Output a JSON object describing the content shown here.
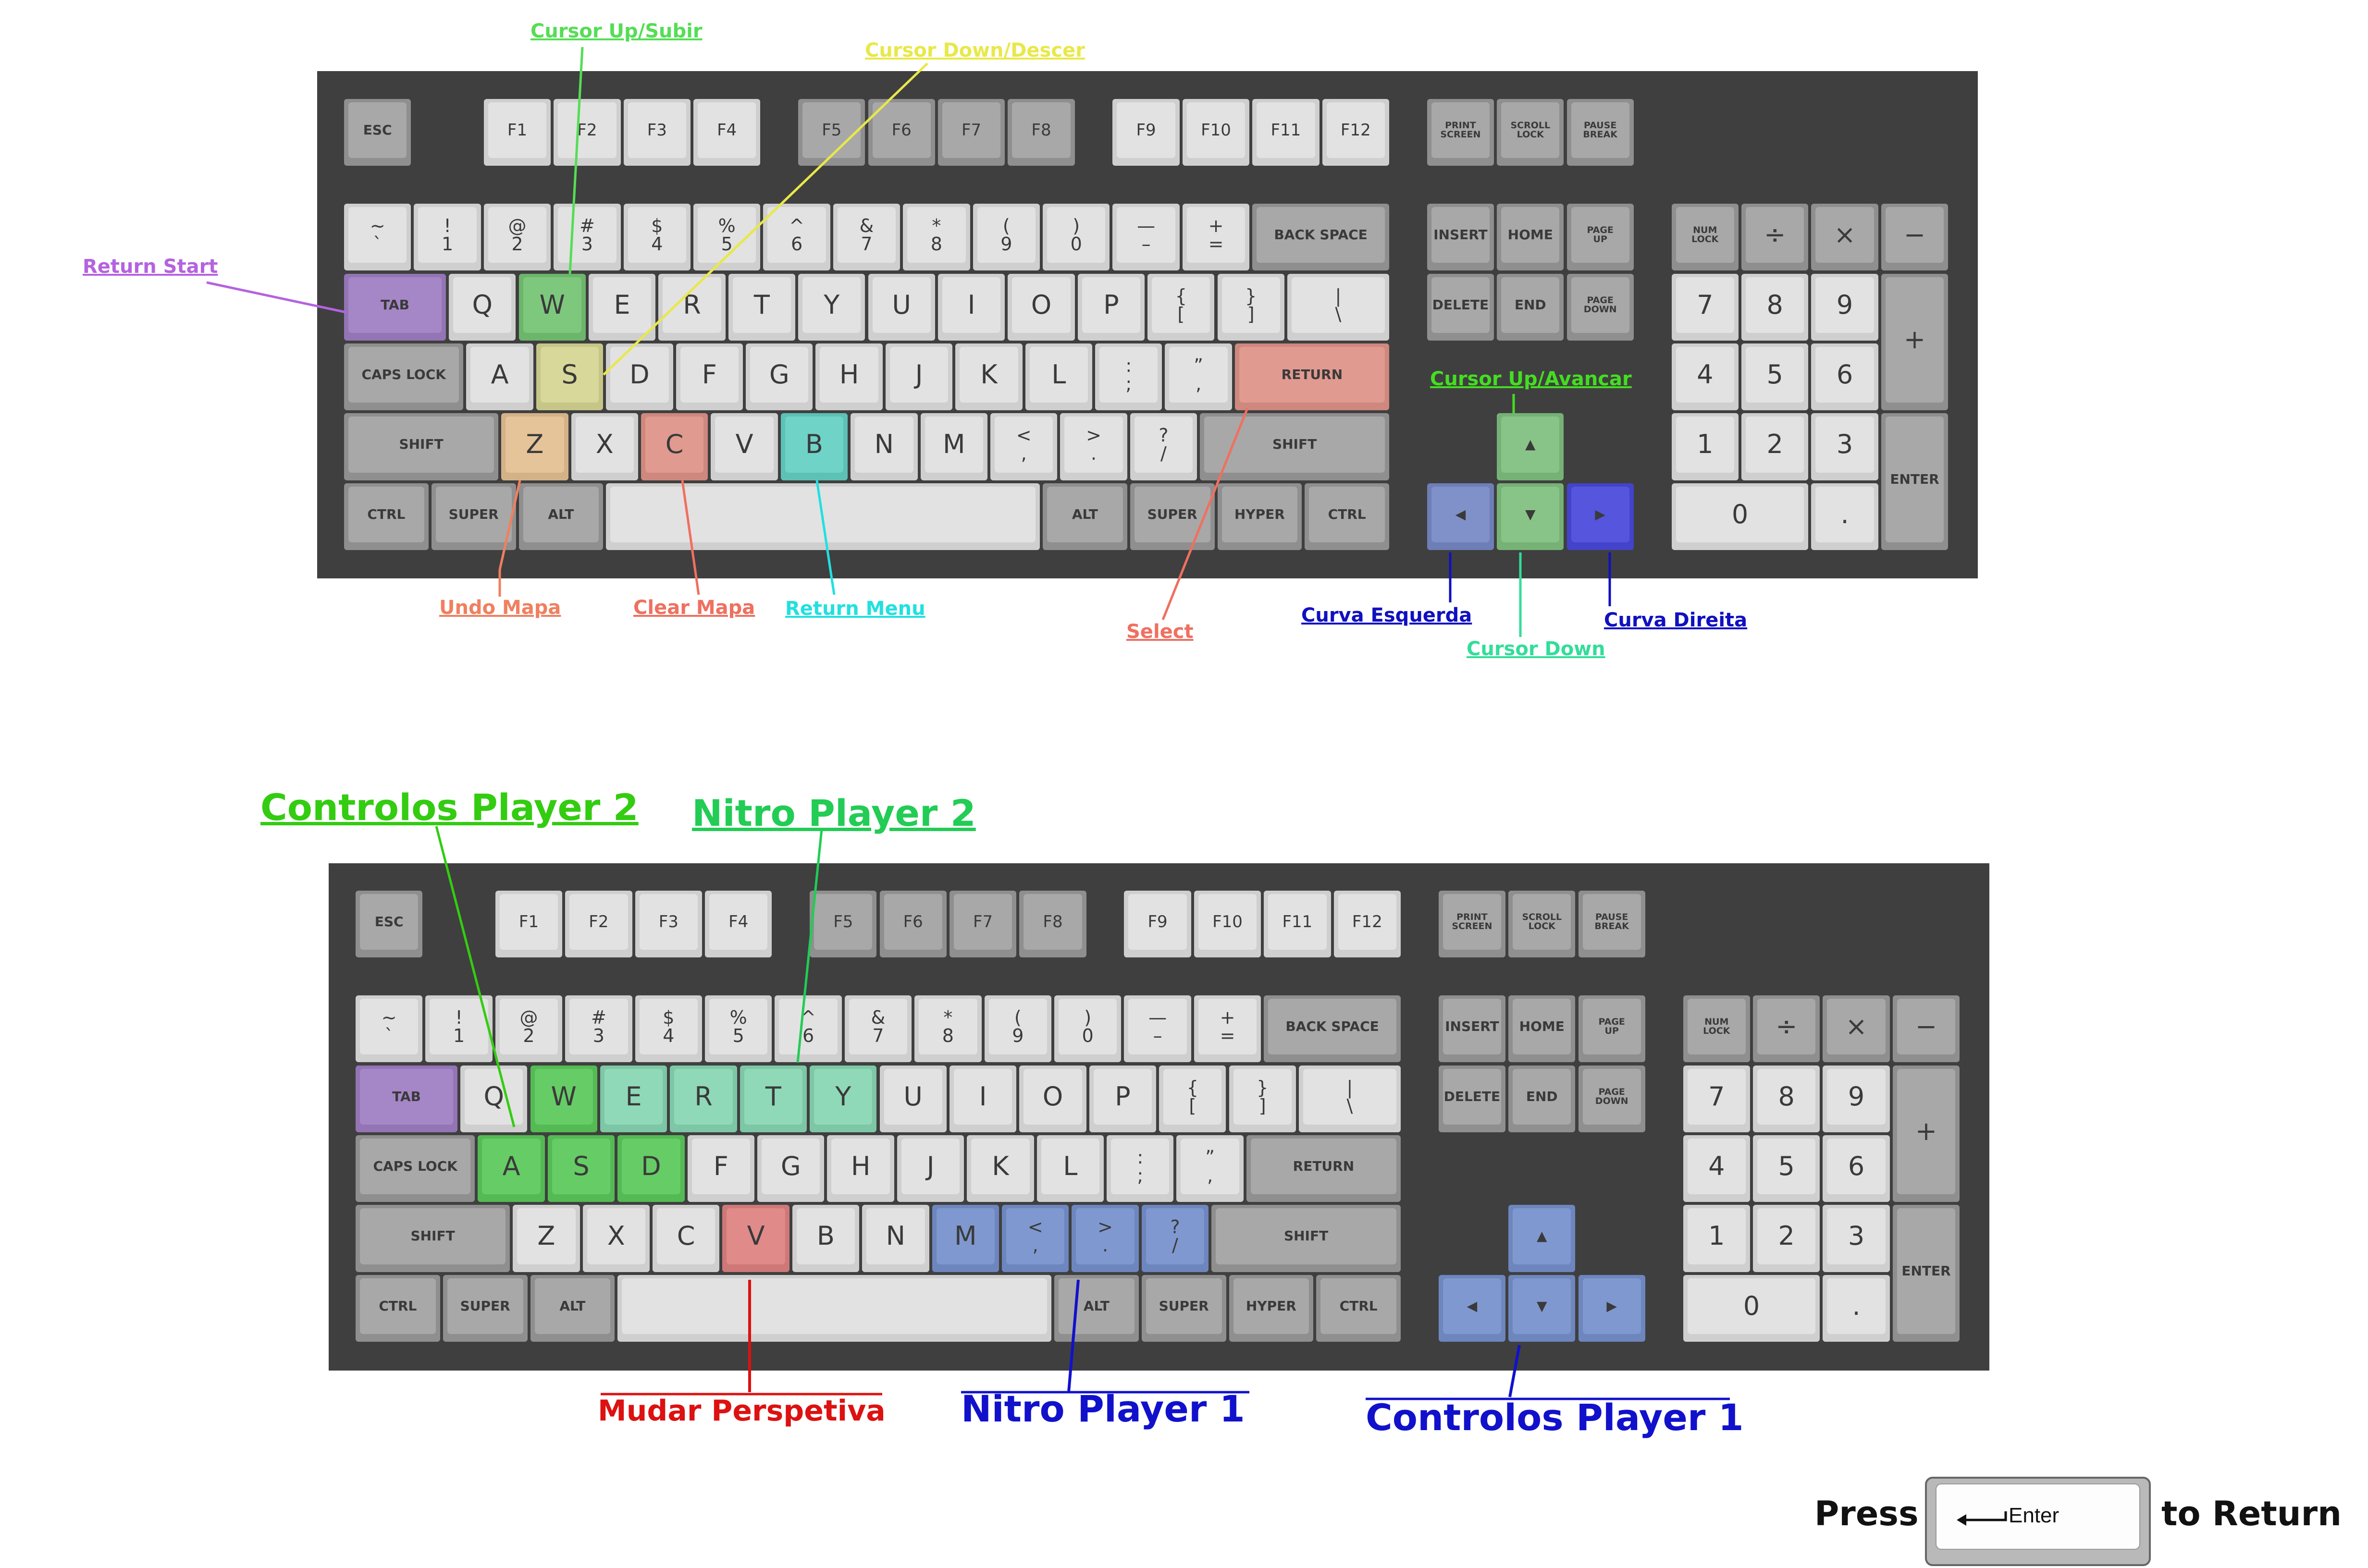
{
  "palette": {
    "board": "#3f3f3f",
    "key_light": "#cfcfcf",
    "key_light_cap": "#e2e2e2",
    "key_dark": "#8f8f8f",
    "key_dark_cap": "#a8a8a8",
    "text": "#3a3a3a",
    "purple": "#a586c6",
    "green": "#7ec87e",
    "yellow": "#d8d89a",
    "orange": "#e6c49a",
    "salmon": "#e09a90",
    "teal": "#6fd3c8",
    "blue_bright": "#5555dd",
    "slate_blue": "#8090c8",
    "nav_green": "#88c488",
    "p2_green": "#66cc66",
    "p2_mint": "#8fd8b8",
    "p1_blue": "#7f98d0",
    "red_key": "#e08a8a"
  },
  "rows": {
    "fn": [
      "ESC",
      "F1",
      "F2",
      "F3",
      "F4",
      "F5",
      "F6",
      "F7",
      "F8",
      "F9",
      "F10",
      "F11",
      "F12"
    ],
    "sys": [
      [
        "PRINT",
        "SCREEN"
      ],
      [
        "SCROLL",
        "LOCK"
      ],
      [
        "PAUSE",
        "BREAK"
      ]
    ],
    "num": [
      [
        "~",
        "`"
      ],
      [
        "!",
        "1"
      ],
      [
        "@",
        "2"
      ],
      [
        "#",
        "3"
      ],
      [
        "$",
        "4"
      ],
      [
        "%",
        "5"
      ],
      [
        "^",
        "6"
      ],
      [
        "&",
        "7"
      ],
      [
        "*",
        "8"
      ],
      [
        "(",
        "9"
      ],
      [
        ")",
        "0"
      ],
      [
        "—",
        "–"
      ],
      [
        "+",
        "="
      ]
    ],
    "backspace": "BACK SPACE",
    "top": [
      "TAB",
      "Q",
      "W",
      "E",
      "R",
      "T",
      "Y",
      "U",
      "I",
      "O",
      "P",
      [
        "{",
        "["
      ],
      [
        "}",
        "]"
      ],
      [
        "|",
        "\\"
      ]
    ],
    "home": [
      "CAPS LOCK",
      "A",
      "S",
      "D",
      "F",
      "G",
      "H",
      "J",
      "K",
      "L",
      [
        ":",
        ";"
      ],
      [
        "”",
        ","
      ],
      "RETURN"
    ],
    "bottom": [
      "SHIFT",
      "Z",
      "X",
      "C",
      "V",
      "B",
      "N",
      "M",
      [
        "<",
        ","
      ],
      [
        ">",
        "."
      ],
      [
        "?",
        "/"
      ],
      "SHIFT"
    ],
    "space": [
      "CTRL",
      "SUPER",
      "ALT",
      "",
      "ALT",
      "SUPER",
      "HYPER",
      "CTRL"
    ],
    "nav1": [
      "INSERT",
      "HOME",
      [
        "PAGE",
        "UP"
      ]
    ],
    "nav2": [
      "DELETE",
      "END",
      [
        "PAGE",
        "DOWN"
      ]
    ],
    "arrows": {
      "up": "▲",
      "left": "◀",
      "down": "▼",
      "right": "▶"
    },
    "numpad": {
      "r1": [
        [
          "NUM",
          "LOCK"
        ],
        "÷",
        "×",
        "−"
      ],
      "r2": [
        "7",
        "8",
        "9"
      ],
      "r3": [
        "4",
        "5",
        "6"
      ],
      "r4": [
        "1",
        "2",
        "3"
      ],
      "zero": "0",
      "dot": ".",
      "plus": "+",
      "enter": "ENTER"
    }
  },
  "callouts_top": {
    "cursor_up_subir": {
      "text": "Cursor Up/Subir",
      "color": "#55dd55"
    },
    "cursor_down_descer": {
      "text": "Cursor Down/Descer",
      "color": "#e8e84a"
    },
    "return_start": {
      "text": "Return Start",
      "color": "#b463e0"
    },
    "cursor_up_avancar": {
      "text": "Cursor Up/Avancar",
      "color": "#44dd22"
    },
    "undo_mapa": {
      "text": "Undo Mapa",
      "color": "#ef8060"
    },
    "clear_mapa": {
      "text": "Clear Mapa",
      "color": "#ef7060"
    },
    "return_menu": {
      "text": "Return Menu",
      "color": "#22e0e0"
    },
    "select": {
      "text": "Select",
      "color": "#ef7060"
    },
    "curva_esquerda": {
      "text": "Curva Esquerda",
      "color": "#1010c0"
    },
    "cursor_down": {
      "text": "Cursor Down",
      "color": "#33dd99"
    },
    "curva_direita": {
      "text": "Curva Direita",
      "color": "#1010c0"
    }
  },
  "callouts_bottom": {
    "controlos_player_2": {
      "text": "Controlos Player 2",
      "color": "#33cc11"
    },
    "nitro_player_2": {
      "text": "Nitro Player 2",
      "color": "#22cc55"
    },
    "mudar_perspetiva": {
      "text": "Mudar Perspetiva",
      "color": "#dd1111"
    },
    "nitro_player_1": {
      "text": "Nitro Player 1",
      "color": "#1111cc"
    },
    "controlos_player_1": {
      "text": "Controlos Player 1",
      "color": "#1111cc"
    }
  },
  "footer": {
    "press": "Press",
    "enter_key": "Enter",
    "to_return": "to Return"
  }
}
